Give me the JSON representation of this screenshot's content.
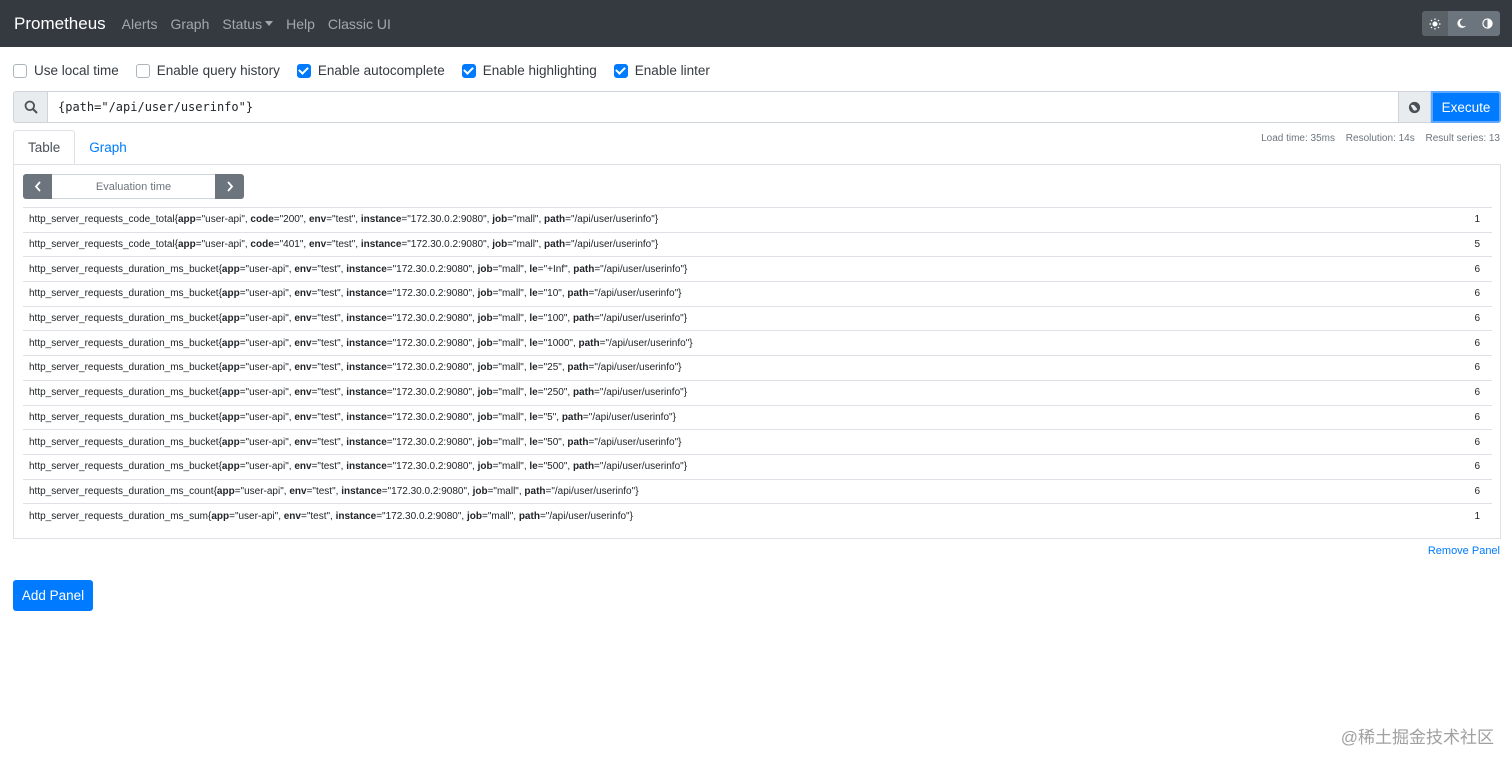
{
  "navbar": {
    "brand": "Prometheus",
    "links": [
      "Alerts",
      "Graph",
      "Status",
      "Help",
      "Classic UI"
    ]
  },
  "settings": [
    {
      "label": "Use local time",
      "checked": false
    },
    {
      "label": "Enable query history",
      "checked": false
    },
    {
      "label": "Enable autocomplete",
      "checked": true
    },
    {
      "label": "Enable highlighting",
      "checked": true
    },
    {
      "label": "Enable linter",
      "checked": true
    }
  ],
  "query": {
    "expression": "{path=\"/api/user/userinfo\"}",
    "execute_label": "Execute"
  },
  "stats": {
    "load_time": "Load time: 35ms",
    "resolution": "Resolution: 14s",
    "result_series": "Result series: 13"
  },
  "tabs": [
    "Table",
    "Graph"
  ],
  "eval": {
    "placeholder": "Evaluation time"
  },
  "results": [
    {
      "metric": "http_server_requests_code_total",
      "labels": [
        [
          "app",
          "user-api"
        ],
        [
          "code",
          "200"
        ],
        [
          "env",
          "test"
        ],
        [
          "instance",
          "172.30.0.2:9080"
        ],
        [
          "job",
          "mall"
        ],
        [
          "path",
          "/api/user/userinfo"
        ]
      ],
      "value": "1"
    },
    {
      "metric": "http_server_requests_code_total",
      "labels": [
        [
          "app",
          "user-api"
        ],
        [
          "code",
          "401"
        ],
        [
          "env",
          "test"
        ],
        [
          "instance",
          "172.30.0.2:9080"
        ],
        [
          "job",
          "mall"
        ],
        [
          "path",
          "/api/user/userinfo"
        ]
      ],
      "value": "5"
    },
    {
      "metric": "http_server_requests_duration_ms_bucket",
      "labels": [
        [
          "app",
          "user-api"
        ],
        [
          "env",
          "test"
        ],
        [
          "instance",
          "172.30.0.2:9080"
        ],
        [
          "job",
          "mall"
        ],
        [
          "le",
          "+Inf"
        ],
        [
          "path",
          "/api/user/userinfo"
        ]
      ],
      "value": "6"
    },
    {
      "metric": "http_server_requests_duration_ms_bucket",
      "labels": [
        [
          "app",
          "user-api"
        ],
        [
          "env",
          "test"
        ],
        [
          "instance",
          "172.30.0.2:9080"
        ],
        [
          "job",
          "mall"
        ],
        [
          "le",
          "10"
        ],
        [
          "path",
          "/api/user/userinfo"
        ]
      ],
      "value": "6"
    },
    {
      "metric": "http_server_requests_duration_ms_bucket",
      "labels": [
        [
          "app",
          "user-api"
        ],
        [
          "env",
          "test"
        ],
        [
          "instance",
          "172.30.0.2:9080"
        ],
        [
          "job",
          "mall"
        ],
        [
          "le",
          "100"
        ],
        [
          "path",
          "/api/user/userinfo"
        ]
      ],
      "value": "6"
    },
    {
      "metric": "http_server_requests_duration_ms_bucket",
      "labels": [
        [
          "app",
          "user-api"
        ],
        [
          "env",
          "test"
        ],
        [
          "instance",
          "172.30.0.2:9080"
        ],
        [
          "job",
          "mall"
        ],
        [
          "le",
          "1000"
        ],
        [
          "path",
          "/api/user/userinfo"
        ]
      ],
      "value": "6"
    },
    {
      "metric": "http_server_requests_duration_ms_bucket",
      "labels": [
        [
          "app",
          "user-api"
        ],
        [
          "env",
          "test"
        ],
        [
          "instance",
          "172.30.0.2:9080"
        ],
        [
          "job",
          "mall"
        ],
        [
          "le",
          "25"
        ],
        [
          "path",
          "/api/user/userinfo"
        ]
      ],
      "value": "6"
    },
    {
      "metric": "http_server_requests_duration_ms_bucket",
      "labels": [
        [
          "app",
          "user-api"
        ],
        [
          "env",
          "test"
        ],
        [
          "instance",
          "172.30.0.2:9080"
        ],
        [
          "job",
          "mall"
        ],
        [
          "le",
          "250"
        ],
        [
          "path",
          "/api/user/userinfo"
        ]
      ],
      "value": "6"
    },
    {
      "metric": "http_server_requests_duration_ms_bucket",
      "labels": [
        [
          "app",
          "user-api"
        ],
        [
          "env",
          "test"
        ],
        [
          "instance",
          "172.30.0.2:9080"
        ],
        [
          "job",
          "mall"
        ],
        [
          "le",
          "5"
        ],
        [
          "path",
          "/api/user/userinfo"
        ]
      ],
      "value": "6"
    },
    {
      "metric": "http_server_requests_duration_ms_bucket",
      "labels": [
        [
          "app",
          "user-api"
        ],
        [
          "env",
          "test"
        ],
        [
          "instance",
          "172.30.0.2:9080"
        ],
        [
          "job",
          "mall"
        ],
        [
          "le",
          "50"
        ],
        [
          "path",
          "/api/user/userinfo"
        ]
      ],
      "value": "6"
    },
    {
      "metric": "http_server_requests_duration_ms_bucket",
      "labels": [
        [
          "app",
          "user-api"
        ],
        [
          "env",
          "test"
        ],
        [
          "instance",
          "172.30.0.2:9080"
        ],
        [
          "job",
          "mall"
        ],
        [
          "le",
          "500"
        ],
        [
          "path",
          "/api/user/userinfo"
        ]
      ],
      "value": "6"
    },
    {
      "metric": "http_server_requests_duration_ms_count",
      "labels": [
        [
          "app",
          "user-api"
        ],
        [
          "env",
          "test"
        ],
        [
          "instance",
          "172.30.0.2:9080"
        ],
        [
          "job",
          "mall"
        ],
        [
          "path",
          "/api/user/userinfo"
        ]
      ],
      "value": "6"
    },
    {
      "metric": "http_server_requests_duration_ms_sum",
      "labels": [
        [
          "app",
          "user-api"
        ],
        [
          "env",
          "test"
        ],
        [
          "instance",
          "172.30.0.2:9080"
        ],
        [
          "job",
          "mall"
        ],
        [
          "path",
          "/api/user/userinfo"
        ]
      ],
      "value": "1"
    }
  ],
  "remove_panel_label": "Remove Panel",
  "add_panel_label": "Add Panel",
  "watermark": "@稀土掘金技术社区",
  "colors": {
    "navbar": "#343a40",
    "accent": "#007bff"
  },
  "icons": [
    "search-icon",
    "globe-icon",
    "chevron-left-icon",
    "chevron-right-icon",
    "sun-icon",
    "moon-icon",
    "contrast-icon"
  ]
}
